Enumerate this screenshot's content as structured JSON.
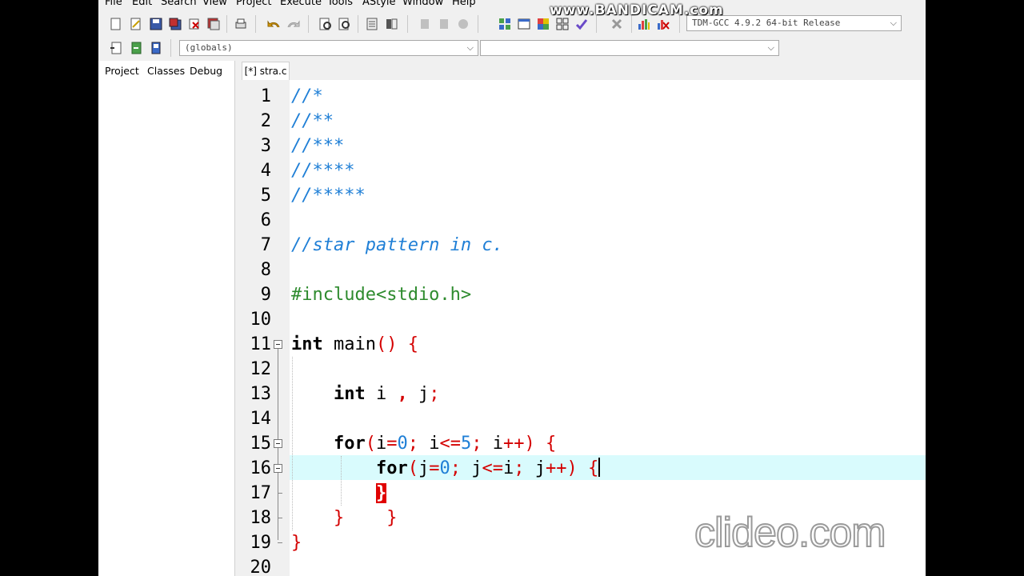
{
  "menu": [
    "File",
    "Edit",
    "Search",
    "View",
    "Project",
    "Execute",
    "Tools",
    "AStyle",
    "Window",
    "Help"
  ],
  "toolbar": {
    "compiler": "TDM-GCC 4.9.2 64-bit Release",
    "scope": "(globals)",
    "symbol": ""
  },
  "panel_tabs": [
    "Project",
    "Classes",
    "Debug"
  ],
  "file_tab": "[*] stra.c",
  "line_numbers": [
    "1",
    "2",
    "3",
    "4",
    "5",
    "6",
    "7",
    "8",
    "9",
    "10",
    "11",
    "12",
    "13",
    "14",
    "15",
    "16",
    "17",
    "18",
    "19",
    "20"
  ],
  "code": {
    "l1": "//*",
    "l2": "//**",
    "l3": "//***",
    "l4": "//****",
    "l5": "//*****",
    "l7": "//star pattern in c.",
    "l9": "#include<stdio.h>",
    "l11_kw": "int",
    "l11_rest": " main",
    "l11_sym": "() {",
    "l13_kw": "int",
    "l13_a": " i ",
    "l13_comma": ",",
    "l13_b": " j",
    "l13_semi": ";",
    "l15_kw": "for",
    "l15_p1": "(",
    "l15_i": "i",
    "l15_eq": "=",
    "l15_0": "0",
    "l15_s1": ";",
    "l15_i2": " i",
    "l15_le": "<=",
    "l15_5": "5",
    "l15_s2": ";",
    "l15_i3": " i",
    "l15_pp": "++",
    "l15_close": ") {",
    "l16_kw": "for",
    "l16_p1": "(",
    "l16_j": "j",
    "l16_eq": "=",
    "l16_0": "0",
    "l16_s1": ";",
    "l16_j2": " j",
    "l16_le": "<=",
    "l16_i": "i",
    "l16_s2": ";",
    "l16_j3": " j",
    "l16_pp": "++",
    "l16_close": ") {",
    "l17": "}",
    "l18a": "}",
    "l18b": "}",
    "l19": "}"
  },
  "watermarks": {
    "top": "www.BANDICAM.com",
    "bottom": "clideo.com"
  }
}
